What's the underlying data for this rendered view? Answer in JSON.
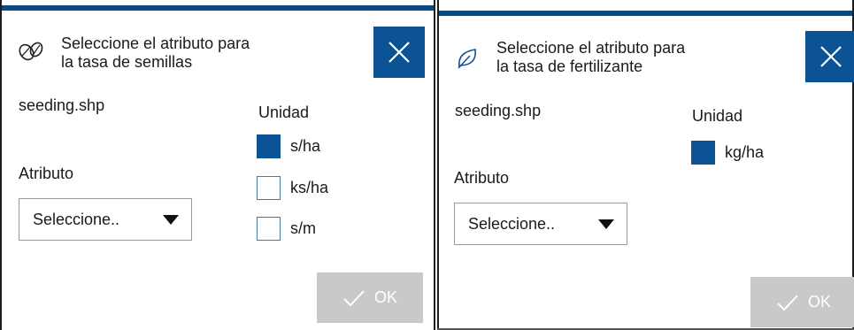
{
  "colors": {
    "accent": "#0b5394",
    "header_bar": "#0b4a85",
    "ok_disabled": "#c9c9c9"
  },
  "left_dialog": {
    "icon": "seeds-icon",
    "title_line1": "Seleccione el atributo para",
    "title_line2": "la tasa de semillas",
    "file": "seeding.shp",
    "unit_heading": "Unidad",
    "attribute_label": "Atributo",
    "select_value": "Seleccione..",
    "units": [
      {
        "label": "s/ha",
        "checked": true
      },
      {
        "label": "ks/ha",
        "checked": false
      },
      {
        "label": "s/m",
        "checked": false
      }
    ],
    "ok_label": "OK"
  },
  "right_dialog": {
    "icon": "leaf-icon",
    "title_line1": "Seleccione el atributo para",
    "title_line2": "la tasa de fertilizante",
    "file": "seeding.shp",
    "unit_heading": "Unidad",
    "attribute_label": "Atributo",
    "select_value": "Seleccione..",
    "units": [
      {
        "label": "kg/ha",
        "checked": true
      }
    ],
    "ok_label": "OK"
  }
}
